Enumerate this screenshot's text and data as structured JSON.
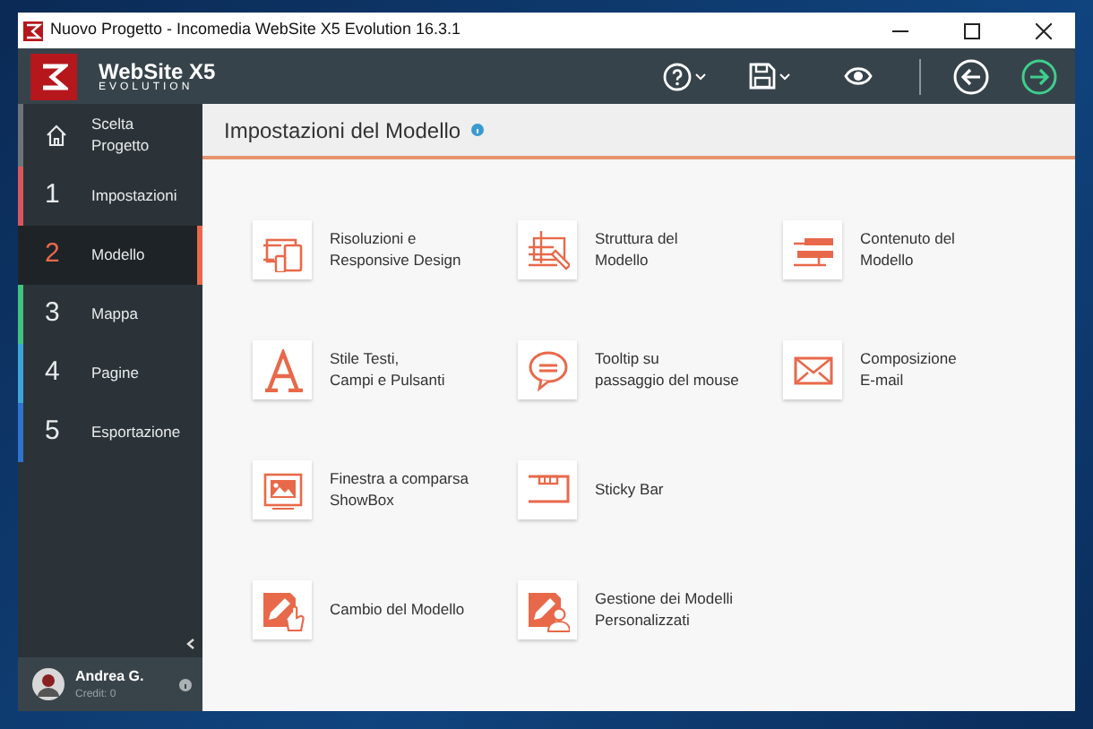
{
  "window": {
    "title": "Nuovo Progetto - Incomedia WebSite X5 Evolution 16.3.1"
  },
  "logo": {
    "name": "WebSite X5",
    "edition": "EVOLUTION"
  },
  "toolbar": [
    {
      "kind": "help",
      "menu": true
    },
    {
      "kind": "save",
      "menu": true
    },
    {
      "kind": "preview",
      "menu": false
    },
    {
      "kind": "back",
      "menu": false
    },
    {
      "kind": "forward",
      "menu": false
    }
  ],
  "sidebar": {
    "items": [
      {
        "kind": "home",
        "label": "Scelta\nProgetto",
        "color": "#6b7479",
        "selected": false
      },
      {
        "kind": "step",
        "number": "1",
        "label": "Impostazioni",
        "color": "#d9575a",
        "selected": false
      },
      {
        "kind": "step",
        "number": "2",
        "label": "Modello",
        "color": "#e8694a",
        "selected": true
      },
      {
        "kind": "step",
        "number": "3",
        "label": "Mappa",
        "color": "#3fc47f",
        "selected": false
      },
      {
        "kind": "step",
        "number": "4",
        "label": "Pagine",
        "color": "#3aa6d8",
        "selected": false
      },
      {
        "kind": "step",
        "number": "5",
        "label": "Esportazione",
        "color": "#2f72d0",
        "selected": false
      }
    ],
    "user": {
      "name": "Andrea G.",
      "credit": "Credit: 0"
    }
  },
  "page": {
    "title": "Impostazioni del Modello"
  },
  "option_rows": [
    {
      "options": [
        {
          "kind": "responsive",
          "label": "Risoluzioni e\nResponsive Design"
        },
        {
          "kind": "structure",
          "label": "Struttura del\nModello"
        },
        {
          "kind": "content",
          "label": "Contenuto del\nModello"
        }
      ]
    },
    {
      "options": [
        {
          "kind": "textstyle",
          "label": "Stile Testi,\nCampi e Pulsanti"
        },
        {
          "kind": "tooltip",
          "label": "Tooltip su\npassaggio del mouse"
        },
        {
          "kind": "email",
          "label": "Composizione\nE-mail"
        }
      ]
    },
    {
      "options": [
        {
          "kind": "showbox",
          "label": "Finestra a comparsa\nShowBox"
        },
        {
          "kind": "stickybar",
          "label": "Sticky Bar"
        }
      ]
    },
    {
      "options": [
        {
          "kind": "change",
          "label": "Cambio del Modello"
        },
        {
          "kind": "manage",
          "label": "Gestione dei Modelli\nPersonalizzati"
        }
      ]
    }
  ]
}
